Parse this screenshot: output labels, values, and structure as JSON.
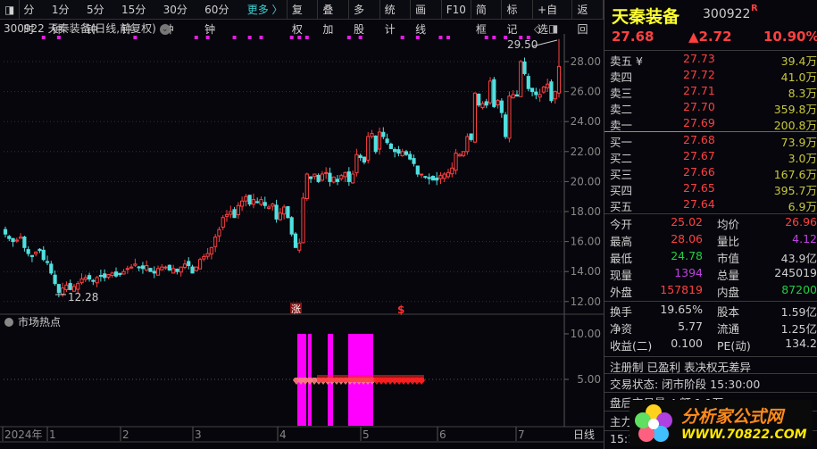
{
  "toolbar": {
    "items": [
      "分时",
      "1分钟",
      "5分钟",
      "15分钟",
      "30分钟",
      "60分钟",
      "更多 〉",
      "复权",
      "叠加",
      "多股",
      "统计",
      "画线",
      "F10",
      "简框",
      "标记",
      "+自选",
      "返回"
    ]
  },
  "chart_header": "300922 天秦装备(日线,前复权)",
  "chart_data": {
    "type": "candlestick",
    "y_ticks": [
      "28.00",
      "26.00",
      "24.00",
      "22.00",
      "20.00",
      "18.00",
      "16.00",
      "14.00",
      "12.00"
    ],
    "ylim": [
      11.6,
      29.8
    ],
    "closes": [
      16.5,
      16.2,
      16.0,
      16.1,
      16.3,
      15.6,
      15.2,
      15.0,
      15.3,
      15.4,
      14.8,
      14.6,
      13.9,
      13.2,
      12.6,
      12.9,
      13.1,
      12.8,
      13.0,
      13.2,
      13.5,
      13.6,
      13.5,
      13.4,
      13.6,
      13.7,
      13.6,
      13.8,
      13.9,
      13.7,
      13.8,
      14.0,
      14.2,
      14.3,
      14.5,
      14.3,
      14.2,
      14.4,
      14.0,
      13.9,
      14.2,
      14.3,
      14.3,
      14.1,
      14.2,
      14.0,
      14.3,
      14.5,
      14.4,
      13.9,
      14.3,
      14.8,
      15.0,
      15.2,
      15.6,
      16.3,
      16.8,
      17.6,
      17.8,
      18.0,
      17.6,
      18.4,
      18.7,
      19.0,
      18.5,
      18.8,
      18.6,
      18.8,
      18.4,
      18.3,
      18.5,
      17.5,
      17.9,
      18.3,
      17.6,
      16.5,
      15.6,
      15.9,
      18.9,
      20.5,
      20.2,
      20.5,
      20.0,
      20.5,
      20.6,
      20.0,
      20.3,
      20.0,
      20.4,
      20.6,
      20.0,
      20.5,
      21.8,
      21.6,
      21.3,
      23.0,
      23.2,
      22.0,
      23.3,
      23.0,
      22.6,
      22.2,
      22.0,
      21.9,
      22.0,
      21.8,
      21.5,
      21.2,
      20.5,
      20.5,
      20.3,
      20.2,
      20.1,
      20.1,
      20.4,
      20.5,
      20.6,
      20.9,
      21.9,
      21.8,
      22.0,
      23.0,
      22.8,
      25.9,
      25.1,
      25.2,
      25.1,
      26.7,
      25.0,
      25.4,
      24.6,
      23.0,
      25.7,
      25.8,
      25.7,
      28.0,
      27.2,
      26.2,
      26.0,
      25.8,
      25.8,
      26.3,
      26.5,
      25.4,
      26.0,
      27.68
    ],
    "annotations": {
      "high": "29.50",
      "low": "12.28"
    },
    "signal_marks": [
      "涨",
      "$"
    ],
    "up_color": "#ff4040",
    "down_color": "#50e0e0",
    "x_labels": [
      "2024年",
      "1",
      "2",
      "3",
      "4",
      "5",
      "6",
      "7"
    ],
    "period_label": "日线",
    "sub": {
      "title": "市场热点",
      "y_ticks": [
        "10.00",
        "5.00"
      ],
      "bar_color": "#ff00ff"
    }
  },
  "quote": {
    "name": "天秦装备",
    "code": "300922",
    "badge": "R",
    "price": "27.68",
    "change": "▲2.72",
    "pct": "10.90%",
    "asks": [
      [
        "卖五 ¥",
        "27.73",
        "39.4万"
      ],
      [
        "卖四",
        "27.72",
        "41.0万"
      ],
      [
        "卖三",
        "27.71",
        "8.3万"
      ],
      [
        "卖二",
        "27.70",
        "359.8万"
      ],
      [
        "卖一",
        "27.69",
        "200.8万"
      ]
    ],
    "bids": [
      [
        "买一",
        "27.68",
        "73.9万"
      ],
      [
        "买二",
        "27.67",
        "3.0万"
      ],
      [
        "买三",
        "27.66",
        "167.6万"
      ],
      [
        "买四",
        "27.65",
        "395.7万"
      ],
      [
        "买五",
        "27.64",
        "6.9万"
      ]
    ],
    "stats": [
      [
        "今开",
        "25.02",
        "均价",
        "26.96"
      ],
      [
        "最高",
        "28.06",
        "量比",
        "4.12"
      ],
      [
        "最低",
        "24.78",
        "市值",
        "43.9亿"
      ],
      [
        "现量",
        "1394",
        "总量",
        "245019"
      ],
      [
        "外盘",
        "157819",
        "内盘",
        "87200"
      ]
    ],
    "stats2": [
      [
        "换手",
        "19.65%",
        "股本",
        "1.59亿"
      ],
      [
        "净资",
        "5.77",
        "流通",
        "1.25亿"
      ],
      [
        "收益(二)",
        "0.100",
        "PE(动)",
        "134.2"
      ]
    ],
    "tags": "注册制 已盈利 表决权无差异",
    "status": "交易状态: 闭市阶段 15:30:00",
    "after": "盘后交易量 4 额 1.1万",
    "main": "主力",
    "time": "15:1"
  },
  "watermark": {
    "title": "分析家公式网",
    "url": "WWW.70822.COM"
  }
}
